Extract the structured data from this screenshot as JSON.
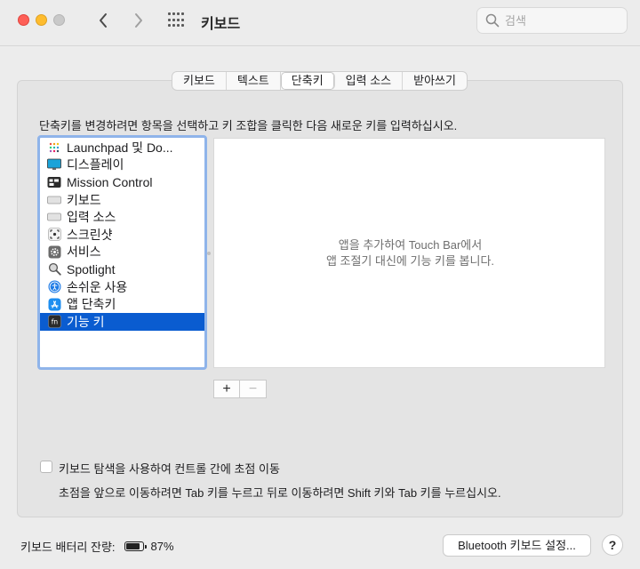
{
  "window": {
    "title": "키보드",
    "search_placeholder": "검색"
  },
  "tabs": [
    {
      "label": "키보드",
      "active": false
    },
    {
      "label": "텍스트",
      "active": false
    },
    {
      "label": "단축키",
      "active": true
    },
    {
      "label": "입력 소스",
      "active": false
    },
    {
      "label": "받아쓰기",
      "active": false
    }
  ],
  "instruction": "단축키를 변경하려면 항목을 선택하고 키 조합을 클릭한 다음 새로운 키를 입력하십시오.",
  "categories": [
    {
      "label": "Launchpad 및 Do...",
      "icon": "launchpad-icon"
    },
    {
      "label": "디스플레이",
      "icon": "display-icon"
    },
    {
      "label": "Mission Control",
      "icon": "mission-control-icon"
    },
    {
      "label": "키보드",
      "icon": "keyboard-icon"
    },
    {
      "label": "입력 소스",
      "icon": "input-source-icon"
    },
    {
      "label": "스크린샷",
      "icon": "screenshot-icon"
    },
    {
      "label": "서비스",
      "icon": "services-gear-icon"
    },
    {
      "label": "Spotlight",
      "icon": "spotlight-icon"
    },
    {
      "label": "손쉬운 사용",
      "icon": "accessibility-icon"
    },
    {
      "label": "앱 단축키",
      "icon": "app-store-icon"
    },
    {
      "label": "기능 키",
      "icon": "fn-key-icon",
      "selected": true
    }
  ],
  "detail": {
    "line1": "앱을 추가하여 Touch Bar에서",
    "line2": "앱 조절기 대신에 기능 키를 봅니다."
  },
  "buttons": {
    "add": "+",
    "remove": "−",
    "bluetooth": "Bluetooth 키보드 설정...",
    "help": "?"
  },
  "keyboard_navigation": {
    "checked": false,
    "label": "키보드 탐색을 사용하여 컨트롤 간에 초점 이동",
    "note": "초점을 앞으로 이동하려면 Tab 키를 누르고 뒤로 이동하려면 Shift 키와 Tab 키를 누르십시오."
  },
  "battery": {
    "label": "키보드 배터리 잔량:",
    "percent": "87%",
    "level": 0.87
  },
  "colors": {
    "accent": "#0a5cd0",
    "list_focus_ring": "#8fb4ea"
  }
}
